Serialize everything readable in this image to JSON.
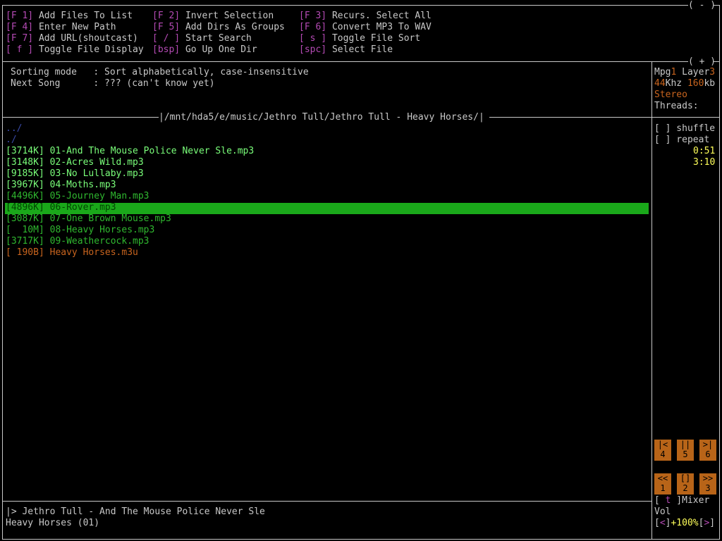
{
  "help": {
    "col1": [
      {
        "key": "[F 1]",
        "label": "Add Files To List"
      },
      {
        "key": "[F 4]",
        "label": "Enter New Path"
      },
      {
        "key": "[F 7]",
        "label": "Add URL(shoutcast)"
      },
      {
        "key": "[ f ]",
        "label": "Toggle File Display"
      }
    ],
    "col2": [
      {
        "key": "[F 2]",
        "label": "Invert Selection"
      },
      {
        "key": "[F 5]",
        "label": "Add Dirs As Groups"
      },
      {
        "key": "[ / ]",
        "label": "Start Search"
      },
      {
        "key": "[bsp]",
        "label": "Go Up One Dir"
      }
    ],
    "col3": [
      {
        "key": "[F 3]",
        "label": "Recurs. Select All"
      },
      {
        "key": "[F 6]",
        "label": "Convert MP3 To WAV"
      },
      {
        "key": "[ s ]",
        "label": "Toggle File Sort"
      },
      {
        "key": "[spc]",
        "label": "Select File"
      }
    ],
    "collapse_btn": "( - )",
    "expand_btn": "( + )"
  },
  "info": {
    "sorting_label": "Sorting mode   ",
    "sorting_value": ": Sort alphabetically, case-insensitive",
    "next_label": "Next Song      ",
    "next_value": ": ??? (can't know yet)"
  },
  "path": "/mnt/hda5/e/music/Jethro Tull/Jethro Tull - Heavy Horses/",
  "nav_entries": [
    "../",
    "./"
  ],
  "files": [
    {
      "size": "[3714K]",
      "name": "01-And The Mouse Police Never Sle.mp3",
      "color": "#7aff7a"
    },
    {
      "size": "[3148K]",
      "name": "02-Acres Wild.mp3",
      "color": "#7aff7a"
    },
    {
      "size": "[9185K]",
      "name": "03-No Lullaby.mp3",
      "color": "#7aff7a"
    },
    {
      "size": "[3967K]",
      "name": "04-Moths.mp3",
      "color": "#7aff7a"
    },
    {
      "size": "[4496K]",
      "name": "05-Journey Man.mp3",
      "color": "#2fb82f"
    },
    {
      "size": "[4896K]",
      "name": "06-Rover.mp3",
      "color": "#004400",
      "selected": true
    },
    {
      "size": "[3087K]",
      "name": "07-One Brown Mouse.mp3",
      "color": "#2fb82f"
    },
    {
      "size": "[  10M]",
      "name": "08-Heavy Horses.mp3",
      "color": "#2fb82f"
    },
    {
      "size": "[3717K]",
      "name": "09-Weathercock.mp3",
      "color": "#2fb82f"
    },
    {
      "size": "[ 190B]",
      "name": "Heavy Horses.m3u",
      "color": "#c8641e"
    }
  ],
  "status": {
    "line1": "|> Jethro Tull - And The Mouse Police Never Sle",
    "line2": "Heavy Horses (01)"
  },
  "side": {
    "mpg": "Mpg",
    "mpg_num": "1",
    "layer": " Layer",
    "layer_num": "3",
    "khz_num": "44",
    "khz": "Khz ",
    "kb_num": "160",
    "kb": "kb",
    "stereo": "Stereo",
    "threads": "Threads:",
    "shuffle": "[ ] shuffle",
    "repeat": "[ ] repeat",
    "elapsed": "0:51",
    "total": "3:10",
    "btn_prev_top": "|<",
    "btn_pause_top": "||",
    "btn_next_top": ">|",
    "btn4": "4",
    "btn5": "5",
    "btn6": "6",
    "btn_rew": "<<",
    "btn_stop": "[]",
    "btn_ff": ">>",
    "btn1": "1",
    "btn2": "2",
    "btn3": "3",
    "mixer_open": "[ ",
    "mixer_key": "t",
    "mixer_close": " ]Mixer",
    "vol": "Vol",
    "vol_dec": "<",
    "vol_value": "+100%",
    "vol_inc": ">"
  },
  "colors": {
    "magenta": "#b44ab4",
    "bright_green": "#7aff7a",
    "green": "#2fb82f",
    "selection_bg": "#1aa81a",
    "orange": "#c8641e",
    "yellow": "#ffff5a"
  }
}
